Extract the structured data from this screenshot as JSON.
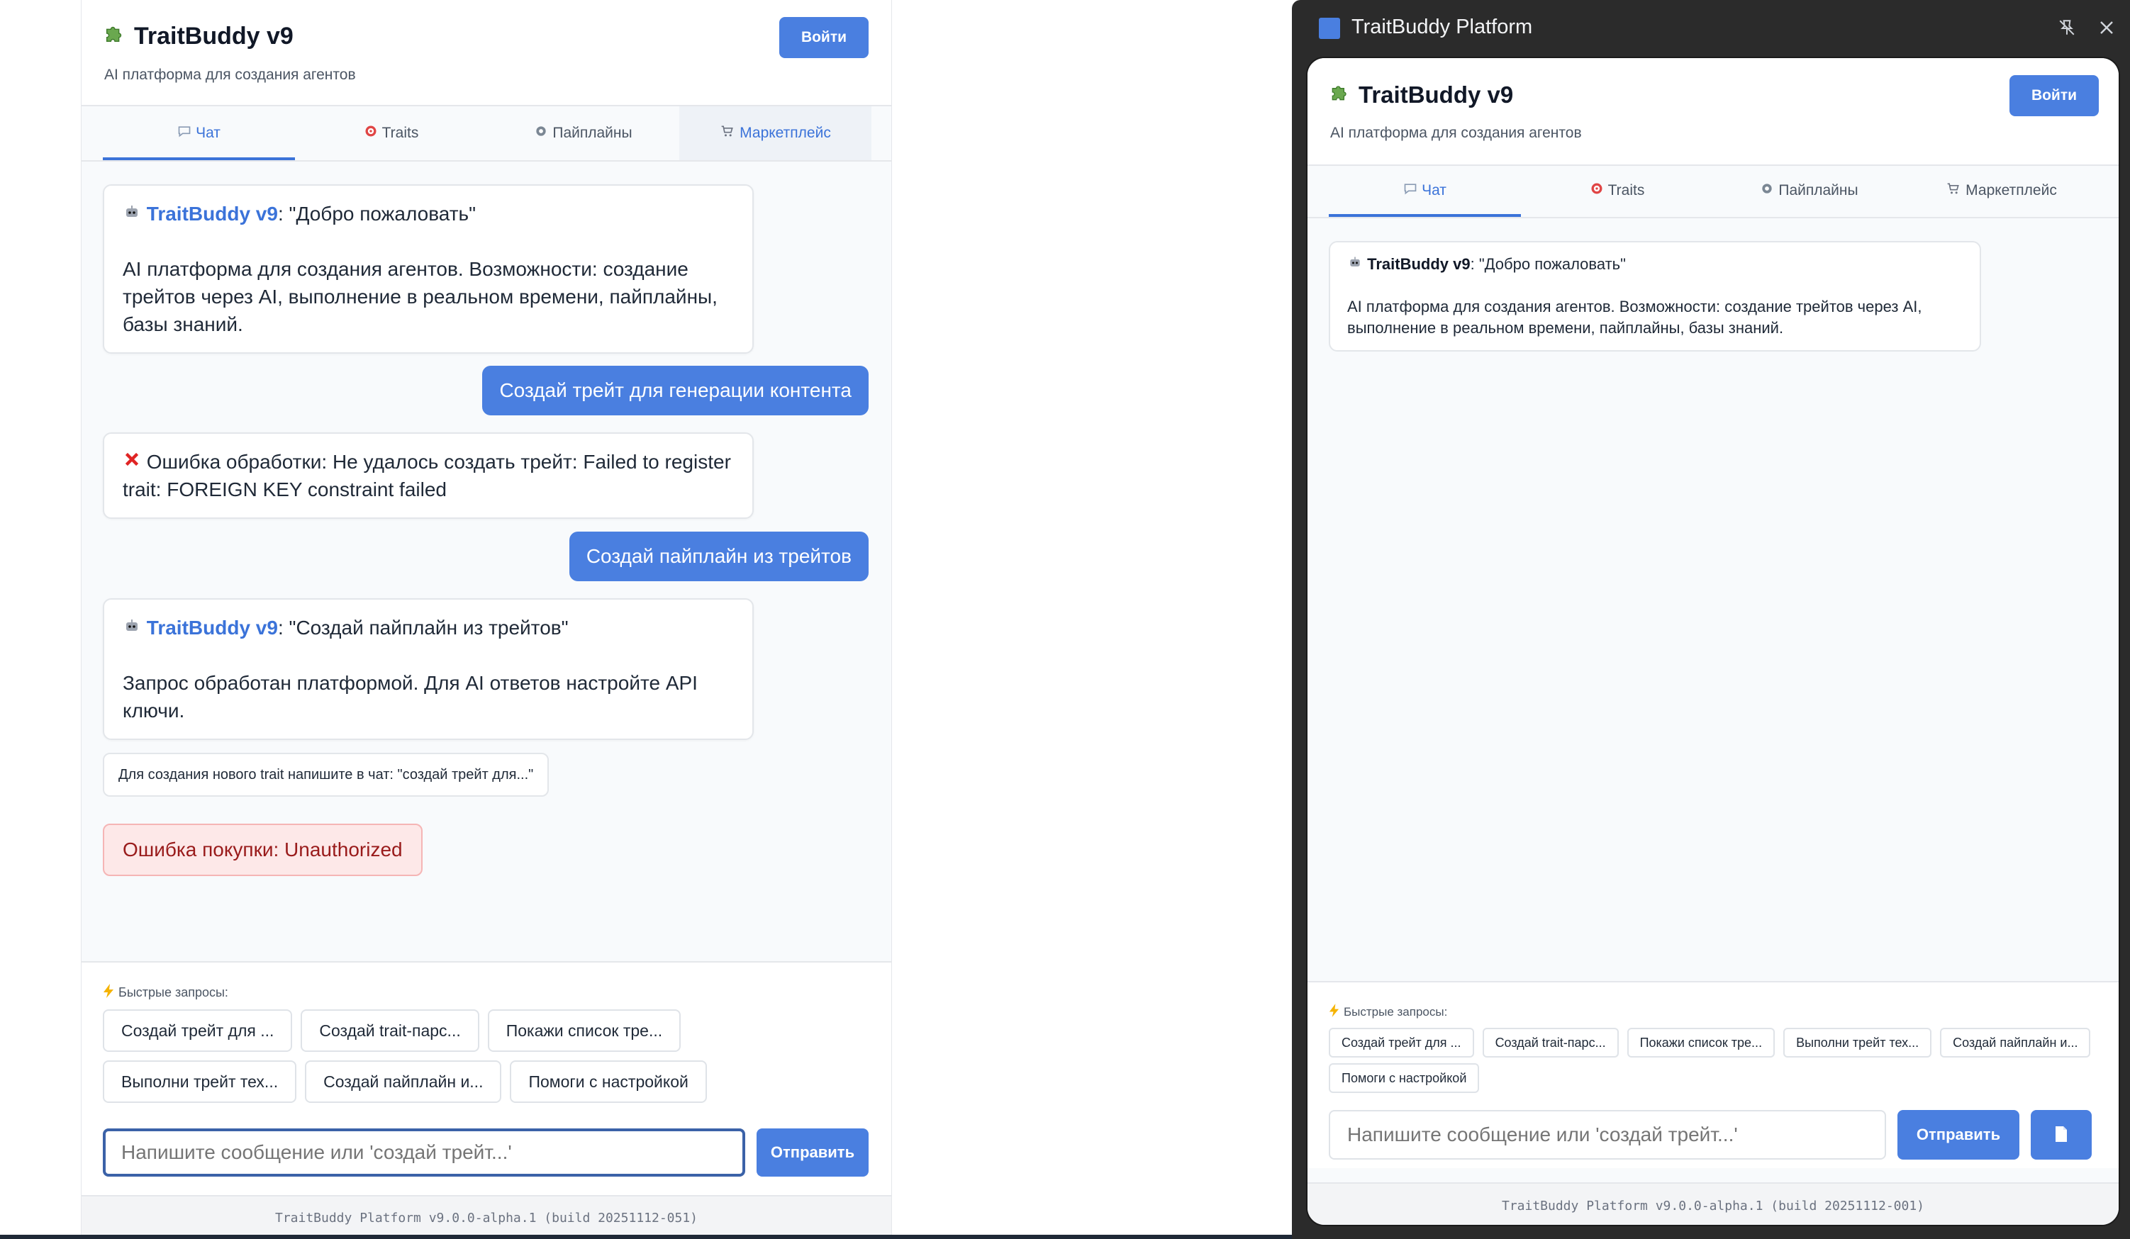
{
  "left": {
    "header": {
      "title": "TraitBuddy v9",
      "subtitle": "AI платформа для создания агентов",
      "login_label": "Войти"
    },
    "tabs": [
      {
        "label": "Чат",
        "icon": "speech-bubble-icon",
        "state": "active"
      },
      {
        "label": "Traits",
        "icon": "target-icon",
        "state": "normal"
      },
      {
        "label": "Пайплайны",
        "icon": "gear-icon",
        "state": "normal"
      },
      {
        "label": "Маркетплейс",
        "icon": "cart-icon",
        "state": "hover"
      }
    ],
    "messages": [
      {
        "role": "bot",
        "name": "TraitBuddy v9",
        "quote": ": \"Добро пожаловать\"",
        "body": "AI платформа для создания агентов. Возможности: создание трейтов через AI, выполнение в реальном времени, пайплайны, базы знаний."
      },
      {
        "role": "user",
        "text": "Создай трейт для генерации контента"
      },
      {
        "role": "error",
        "text": "Ошибка обработки: Не удалось создать трейт: Failed to register trait: FOREIGN KEY constraint failed"
      },
      {
        "role": "user",
        "text": "Создай пайплайн из трейтов"
      },
      {
        "role": "bot",
        "name": "TraitBuddy v9",
        "quote": ": \"Создай пайплайн из трейтов\"",
        "body": "Запрос обработан платформой. Для AI ответов настройте API ключи."
      }
    ],
    "note": "Для создания нового trait напишите в чат: \"создай трейт для...\"",
    "purchase_error": "Ошибка покупки: Unauthorized",
    "quick": {
      "label": "Быстрые запросы:",
      "chips": [
        "Создай трейт для ...",
        "Создай trait-парс...",
        "Покажи список тре...",
        "Выполни трейт тех...",
        "Создай пайплайн и...",
        "Помоги с настройкой"
      ]
    },
    "input": {
      "placeholder": "Напишите сообщение или 'создай трейт...'",
      "send_label": "Отправить"
    },
    "footer": "TraitBuddy Platform v9.0.0-alpha.1 (build 20251112-051)"
  },
  "right": {
    "window_title": "TraitBuddy Platform",
    "header": {
      "title": "TraitBuddy v9",
      "subtitle": "AI платформа для создания агентов",
      "login_label": "Войти"
    },
    "tabs": [
      {
        "label": "Чат",
        "icon": "speech-bubble-icon",
        "state": "active"
      },
      {
        "label": "Traits",
        "icon": "target-icon",
        "state": "normal"
      },
      {
        "label": "Пайплайны",
        "icon": "gear-icon",
        "state": "normal"
      },
      {
        "label": "Маркетплейс",
        "icon": "cart-icon",
        "state": "normal"
      }
    ],
    "message": {
      "name": "TraitBuddy v9",
      "quote": ": \"Добро пожаловать\"",
      "body": "AI платформа для создания агентов. Возможности: создание трейтов через AI, выполнение в реальном времени, пайплайны, базы знаний."
    },
    "quick": {
      "label": "Быстрые запросы:",
      "chips": [
        "Создай трейт для ...",
        "Создай trait-парс...",
        "Покажи список тре...",
        "Выполни трейт тех...",
        "Создай пайплайн и...",
        "Помоги с настройкой"
      ]
    },
    "input": {
      "placeholder": "Напишите сообщение или 'создай трейт...'",
      "send_label": "Отправить"
    },
    "footer": "TraitBuddy Platform v9.0.0-alpha.1 (build 20251112-001)"
  },
  "colors": {
    "accent": "#4a7fe0",
    "error_bg": "#fde8e8",
    "error_text": "#991b1b",
    "titlebar": "#2b2b2b"
  }
}
